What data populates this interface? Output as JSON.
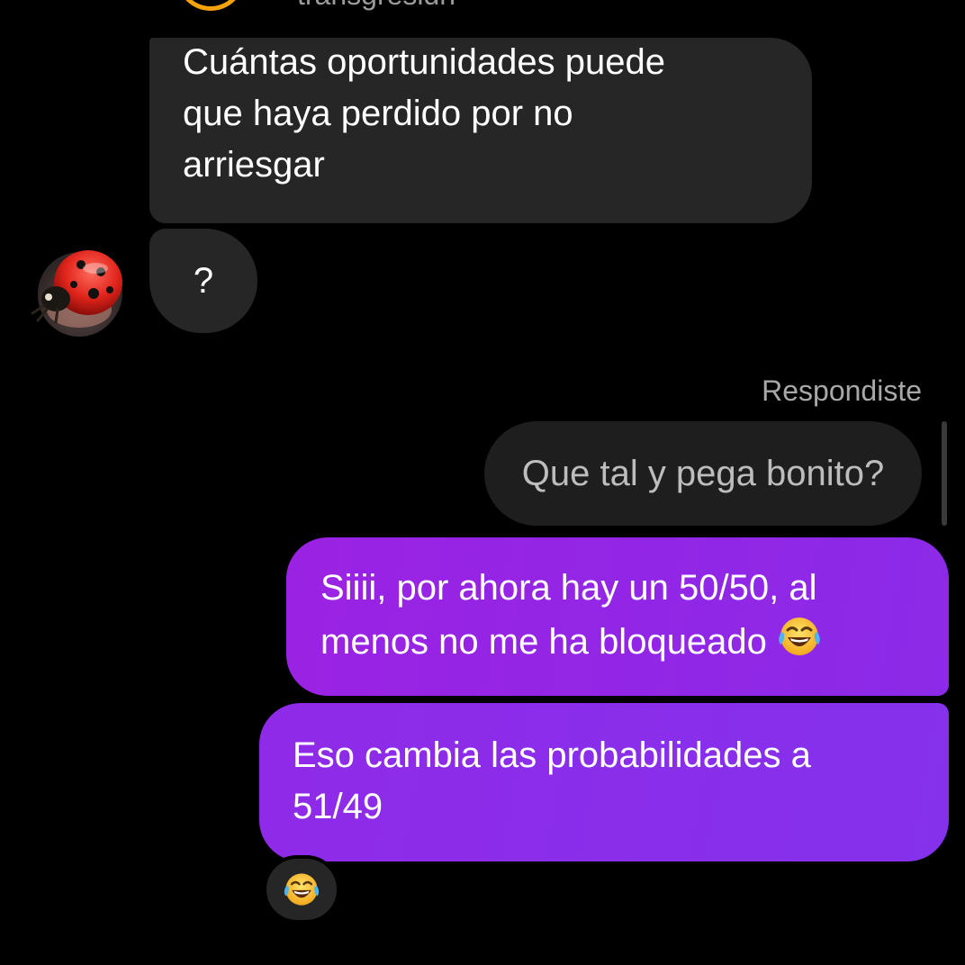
{
  "header": {
    "username": "trahsgresidh"
  },
  "messages": {
    "incoming_1": "Cuántas oportunidades puede que haya perdido por no arriesgar",
    "incoming_1_line1": "Cuántas oportunidades puede",
    "incoming_1_line2": "que haya perdido por no",
    "incoming_1_line3": "arriesgar",
    "incoming_2": "?",
    "replied_label": "Respondiste",
    "quoted_reply": "Que tal y pega bonito?",
    "outgoing_1_line1": "Siiii, por ahora hay un 50/50, al",
    "outgoing_1_line2": "menos no me ha bloqueado",
    "outgoing_2_line1": "Eso cambia las probabilidades a",
    "outgoing_2_line2": "51/49"
  },
  "icons": {
    "contact_avatar": "ladybug-avatar-icon",
    "laughing_emoji": "face-with-tears-of-joy-icon",
    "reaction": "face-with-tears-of-joy-icon"
  },
  "colors": {
    "background": "#000000",
    "incoming_bubble": "#262626",
    "outgoing_bubble_start": "#9b22e3",
    "outgoing_bubble_end": "#8531ec",
    "story_ring": "#f5a20c"
  }
}
